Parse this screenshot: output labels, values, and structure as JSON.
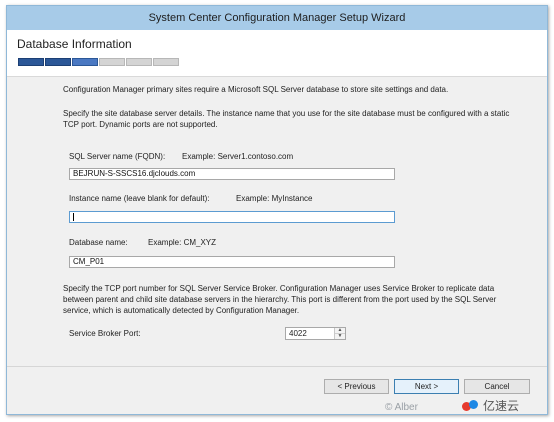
{
  "window": {
    "title": "System Center Configuration Manager Setup Wizard"
  },
  "header": {
    "page_title": "Database Information",
    "progress": {
      "total_steps": 6,
      "completed_steps": 2,
      "current_step": 3
    }
  },
  "content": {
    "intro": "Configuration Manager primary sites require a Microsoft SQL Server database to store site settings and data.",
    "instructions": "Specify the site database server details. The instance name that you use for the site database must be configured with a static TCP port. Dynamic ports are not supported.",
    "sql_server": {
      "label": "SQL Server name (FQDN):",
      "example": "Example: Server1.contoso.com",
      "value": "BEJRUN-S-SSCS16.djclouds.com"
    },
    "instance": {
      "label": "Instance name (leave blank for default):",
      "example": "Example: MyInstance",
      "value": ""
    },
    "database": {
      "label": "Database name:",
      "example": "Example: CM_XYZ",
      "value": "CM_P01"
    },
    "broker_text": "Specify the TCP port number for SQL Server Service Broker. Configuration Manager uses Service Broker to replicate data between parent and child site database servers in the hierarchy. This port is different from the port used by the SQL Server service, which is automatically detected by Configuration Manager.",
    "broker_port": {
      "label": "Service Broker Port:",
      "value": "4022"
    }
  },
  "footer": {
    "previous_label": "< Previous",
    "next_label": "Next >",
    "cancel_label": "Cancel"
  },
  "watermarks": {
    "left_text": "© Alber",
    "right_text": "亿速云"
  },
  "colors": {
    "titlebar": "#a7cbe8",
    "progress_fill": "#2b5797",
    "window_bg": "#f0f0f0"
  }
}
